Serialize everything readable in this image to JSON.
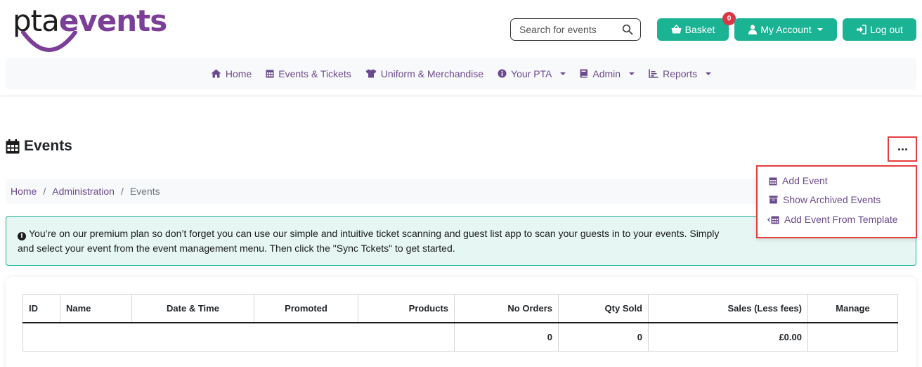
{
  "brand": {
    "name_part1": "pta",
    "name_part2": "events",
    "accent_color": "#7b3f98",
    "teal_color": "#1ab394"
  },
  "search": {
    "placeholder": "Search for events"
  },
  "header_buttons": {
    "basket_label": "Basket",
    "basket_count": "0",
    "account_label": "My Account",
    "logout_label": "Log out"
  },
  "nav": {
    "items": [
      {
        "label": "Home",
        "icon": "home-icon"
      },
      {
        "label": "Events & Tickets",
        "icon": "calendar-icon"
      },
      {
        "label": "Uniform & Merchandise",
        "icon": "shirt-icon"
      },
      {
        "label": "Your PTA",
        "icon": "info-icon",
        "dropdown": true
      },
      {
        "label": "Admin",
        "icon": "book-icon",
        "dropdown": true
      },
      {
        "label": "Reports",
        "icon": "chart-icon",
        "dropdown": true
      }
    ]
  },
  "page": {
    "title": "Events"
  },
  "breadcrumb": {
    "items": [
      "Home",
      "Administration",
      "Events"
    ]
  },
  "actions_menu": {
    "items": [
      {
        "label": "Add Event",
        "icon": "calendar-icon"
      },
      {
        "label": "Show Archived Events",
        "icon": "archive-icon"
      },
      {
        "label": "Add Event From Template",
        "icon": "calendar-template-icon"
      }
    ]
  },
  "alert": {
    "line1": "You’re on our premium plan so don’t forget you can use our simple and intuitive ticket scanning and guest list app to scan your guests in to your events. Simply",
    "line2": "and select your event from the event management menu. Then click the \"Sync Tckets\" to get started."
  },
  "table": {
    "headers": [
      "ID",
      "Name",
      "Date & Time",
      "Promoted",
      "Products",
      "No Orders",
      "Qty Sold",
      "Sales (Less fees)",
      "Manage"
    ],
    "totals": {
      "no_orders": "0",
      "qty_sold": "0",
      "sales": "£0.00"
    }
  }
}
